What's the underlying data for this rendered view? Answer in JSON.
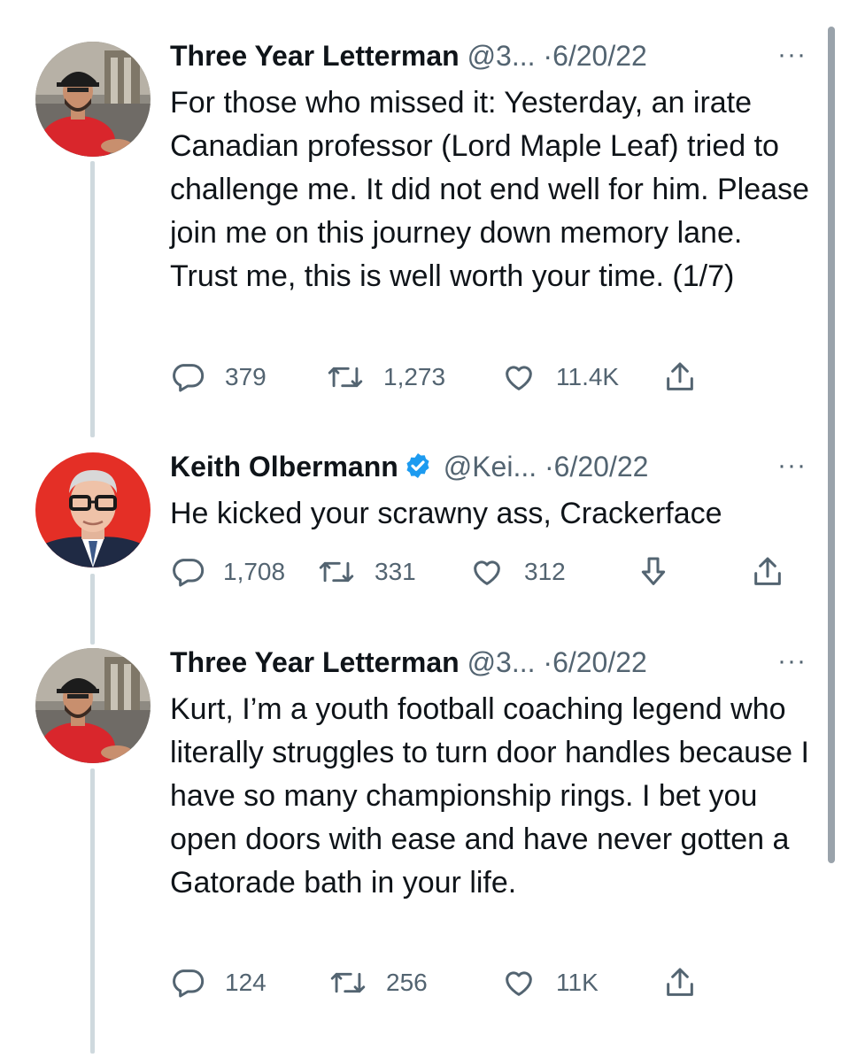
{
  "tweets": [
    {
      "name": "Three Year Letterman",
      "handle": "@3...",
      "separator": "·",
      "date": "6/20/22",
      "text": "For those who missed it: Yesterday, an irate Canadian professor (Lord Maple Leaf) tried to challenge me. It did not end well for him. Please join me on this journey down memory lane. Trust me, this is well worth your time. (1/7)",
      "replies": "379",
      "retweets": "1,273",
      "likes": "11.4K",
      "avatar_icon": "user-photo-red-shirt"
    },
    {
      "name": "Keith Olbermann",
      "handle": "@Kei...",
      "separator": "·",
      "date": "6/20/22",
      "verified": true,
      "text": "He kicked your scrawny ass, Crackerface",
      "replies": "1,708",
      "retweets": "331",
      "likes": "312",
      "avatar_icon": "user-photo-glasses-red-bg"
    },
    {
      "name": "Three Year Letterman",
      "handle": "@3...",
      "separator": "·",
      "date": "6/20/22",
      "text": "Kurt, I’m a youth football coaching legend who literally struggles to turn door handles because I have so many championship rings. I bet you open doors with ease and have never gotten a Gatorade bath in your life.",
      "replies": "124",
      "retweets": "256",
      "likes": "11K",
      "avatar_icon": "user-photo-red-shirt"
    }
  ],
  "more_label": "···",
  "colors": {
    "text": "#0f1419",
    "muted": "#536471",
    "verified": "#1d9bf0",
    "thread_line": "#cfd9de"
  }
}
